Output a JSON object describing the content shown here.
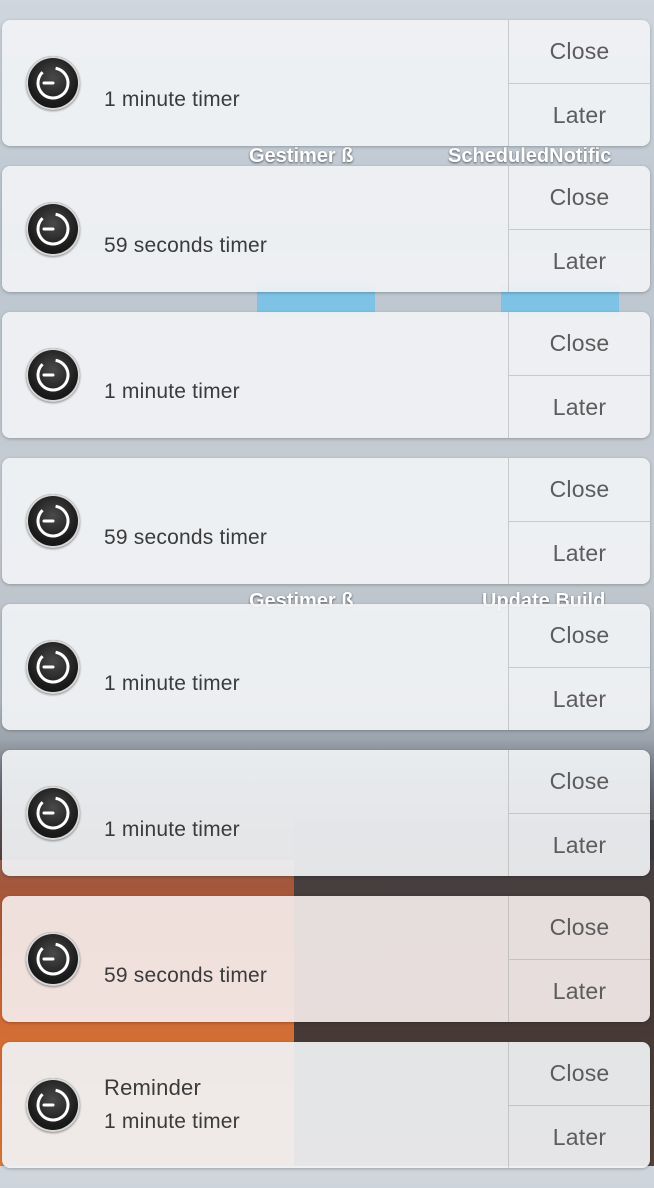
{
  "desktop": {
    "labels": [
      {
        "text": "Gestimer ß"
      },
      {
        "text": "ScheduledNotific"
      },
      {
        "text": "Gestimer ß"
      },
      {
        "text": "Update Build"
      }
    ]
  },
  "notifications": [
    {
      "title": "",
      "message": "1 minute timer",
      "close_label": "Close",
      "later_label": "Later",
      "icon": "timer-icon"
    },
    {
      "title": "",
      "message": "59 seconds timer",
      "close_label": "Close",
      "later_label": "Later",
      "icon": "timer-icon"
    },
    {
      "title": "",
      "message": "1 minute timer",
      "close_label": "Close",
      "later_label": "Later",
      "icon": "timer-icon"
    },
    {
      "title": "",
      "message": "59 seconds timer",
      "close_label": "Close",
      "later_label": "Later",
      "icon": "timer-icon"
    },
    {
      "title": "",
      "message": "1 minute timer",
      "close_label": "Close",
      "later_label": "Later",
      "icon": "timer-icon"
    },
    {
      "title": "",
      "message": "1 minute timer",
      "close_label": "Close",
      "later_label": "Later",
      "icon": "timer-icon"
    },
    {
      "title": "",
      "message": "59 seconds timer",
      "close_label": "Close",
      "later_label": "Later",
      "icon": "timer-icon"
    },
    {
      "title": "Reminder",
      "message": "1 minute timer",
      "close_label": "Close",
      "later_label": "Later",
      "icon": "timer-icon"
    }
  ]
}
